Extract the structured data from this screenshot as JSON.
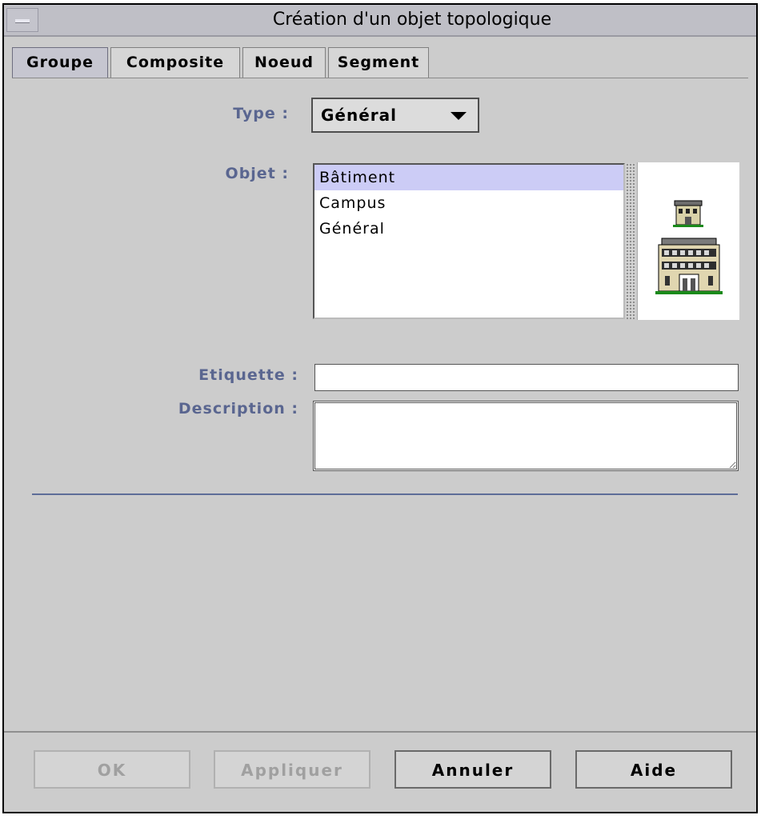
{
  "window": {
    "title": "Création d'un objet topologique"
  },
  "tabs": [
    {
      "label": "Groupe",
      "active": true
    },
    {
      "label": "Composite",
      "active": false
    },
    {
      "label": "Noeud",
      "active": false
    },
    {
      "label": "Segment",
      "active": false
    }
  ],
  "form": {
    "type_label": "Type :",
    "type_value": "Général",
    "object_label": "Objet :",
    "objects": [
      "Bâtiment",
      "Campus",
      "Général"
    ],
    "selected_object": "Bâtiment",
    "label_label": "Etiquette :",
    "label_value": "",
    "description_label": "Description :",
    "description_value": ""
  },
  "buttons": {
    "ok": "OK",
    "apply": "Appliquer",
    "cancel": "Annuler",
    "help": "Aide"
  },
  "colors": {
    "label": "#5a6690",
    "selection": "#ccccf6",
    "separator": "#5d6d98"
  },
  "icons": [
    "window-menu-icon",
    "small-building-icon",
    "large-building-icon"
  ]
}
